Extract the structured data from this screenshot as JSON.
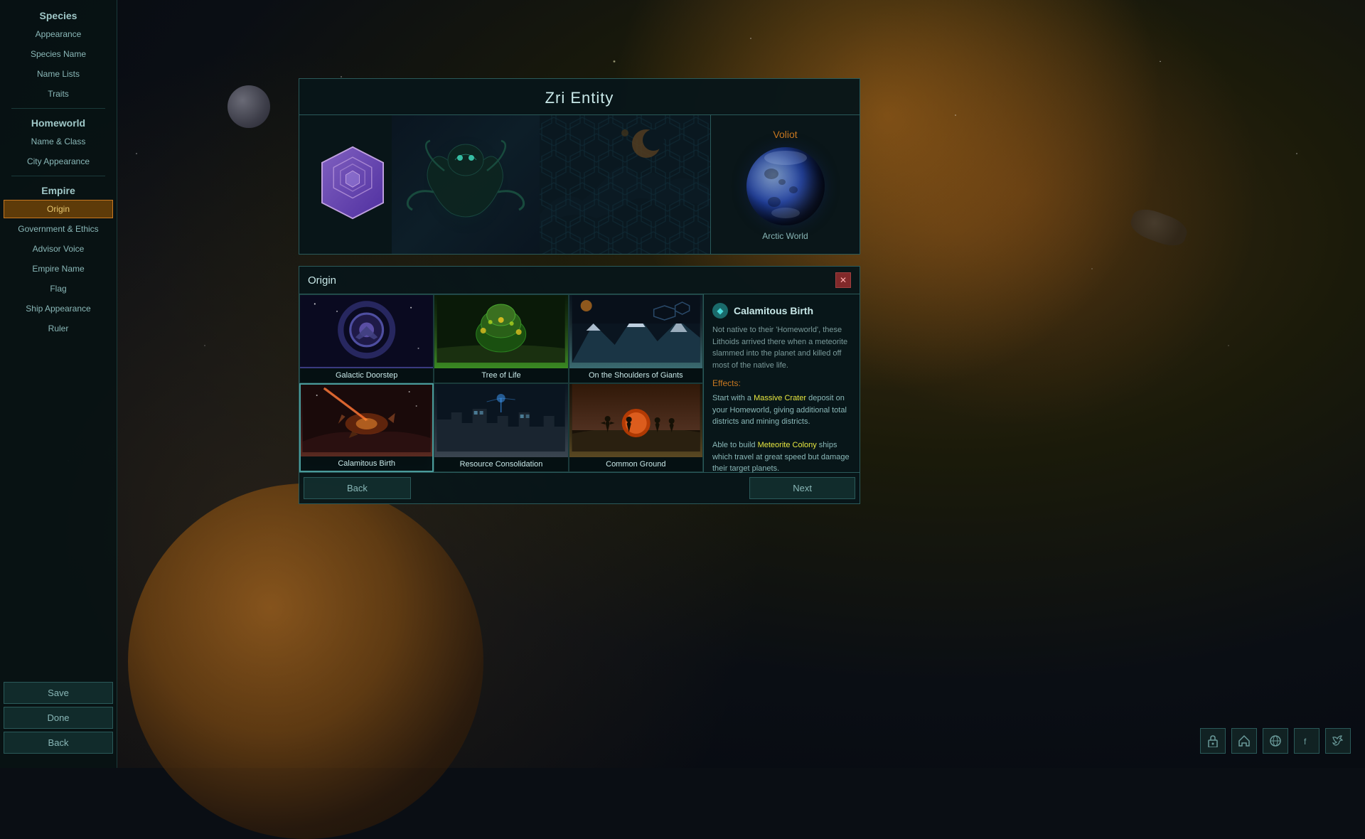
{
  "background": {
    "color": "#0a0e14"
  },
  "sidebar": {
    "species_section": "Species",
    "homeworld_section": "Homeworld",
    "empire_section": "Empire",
    "items": {
      "appearance": "Appearance",
      "species_name": "Species Name",
      "name_lists": "Name Lists",
      "traits": "Traits",
      "name_class": "Name & Class",
      "city_appearance": "City Appearance",
      "origin": "Origin",
      "government_ethics": "Government & Ethics",
      "advisor_voice": "Advisor Voice",
      "empire_name": "Empire Name",
      "flag": "Flag",
      "ship_appearance": "Ship Appearance",
      "ruler": "Ruler"
    },
    "save_btn": "Save",
    "done_btn": "Done",
    "back_btn": "Back"
  },
  "panel": {
    "title": "Zri Entity",
    "planet_name": "Voliot",
    "planet_type": "Arctic World"
  },
  "origin": {
    "section_title": "Origin",
    "items": [
      {
        "id": "galactic_doorstep",
        "label": "Galactic Doorstep",
        "selected": false
      },
      {
        "id": "tree_of_life",
        "label": "Tree of Life",
        "selected": false
      },
      {
        "id": "on_the_shoulders",
        "label": "On the Shoulders of Giants",
        "selected": false
      },
      {
        "id": "calamitous_birth",
        "label": "Calamitous Birth",
        "selected": true
      },
      {
        "id": "resource_consolidation",
        "label": "Resource Consolidation",
        "selected": false
      },
      {
        "id": "common_ground",
        "label": "Common Ground",
        "selected": false
      }
    ],
    "detail": {
      "title": "Calamitous Birth",
      "description": "Not native to their 'Homeworld', these Lithoids arrived there when a meteorite slammed into the planet and killed off most of the native life.",
      "effects_label": "Effects:",
      "effects": [
        "Start with a Massive Crater deposit on your Homeworld, giving additional total districts and mining districts.",
        "Able to build Meteorite Colony ships which travel at great speed but damage their target planets."
      ],
      "massive_crater_highlight": "Massive Crater",
      "meteorite_colony_highlight": "Meteorite Colony"
    }
  },
  "nav": {
    "back_btn": "Back",
    "next_btn": "Next"
  },
  "bottom_icons": {
    "lock": "🔒",
    "home": "🏠",
    "globe": "🌐",
    "facebook": "f",
    "twitter": "t"
  }
}
